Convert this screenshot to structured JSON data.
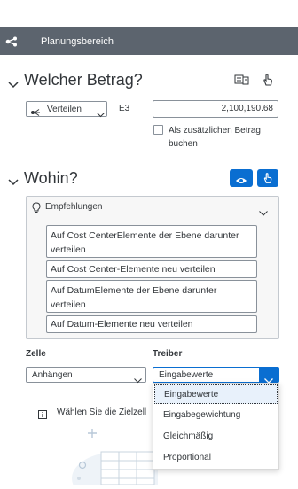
{
  "header": {
    "title": "Planungsbereich",
    "icon": "share-icon"
  },
  "amount_section": {
    "title": "Welcher Betrag?",
    "method_select": {
      "value": "Verteilen",
      "icon": "distribute-icon"
    },
    "field_label": "E3",
    "amount_value": "2,100,190.68",
    "checkbox_label": "Als zusätzlichen Betrag buchen",
    "checkbox_checked": false
  },
  "target_section": {
    "title": "Wohin?",
    "recommendations": {
      "title": "Empfehlungen",
      "items": [
        "Auf Cost CenterElemente der Ebene darunter verteilen",
        "Auf Cost Center-Elemente neu verteilen",
        "Auf DatumElemente der Ebene darunter verteilen",
        "Auf Datum-Elemente neu verteilen"
      ]
    },
    "cell": {
      "label": "Zelle",
      "value": "Anhängen"
    },
    "driver": {
      "label": "Treiber",
      "value": "Eingabewerte",
      "options": [
        "Eingabewerte",
        "Eingabegewichtung",
        "Gleichmäßig",
        "Proportional"
      ],
      "selected_index": 0
    },
    "info_text": "Wählen Sie die Zielzell"
  },
  "colors": {
    "header_bg": "#5c646e",
    "accent": "#0a6ed1",
    "selected_item_bg": "#e8f1fb"
  }
}
